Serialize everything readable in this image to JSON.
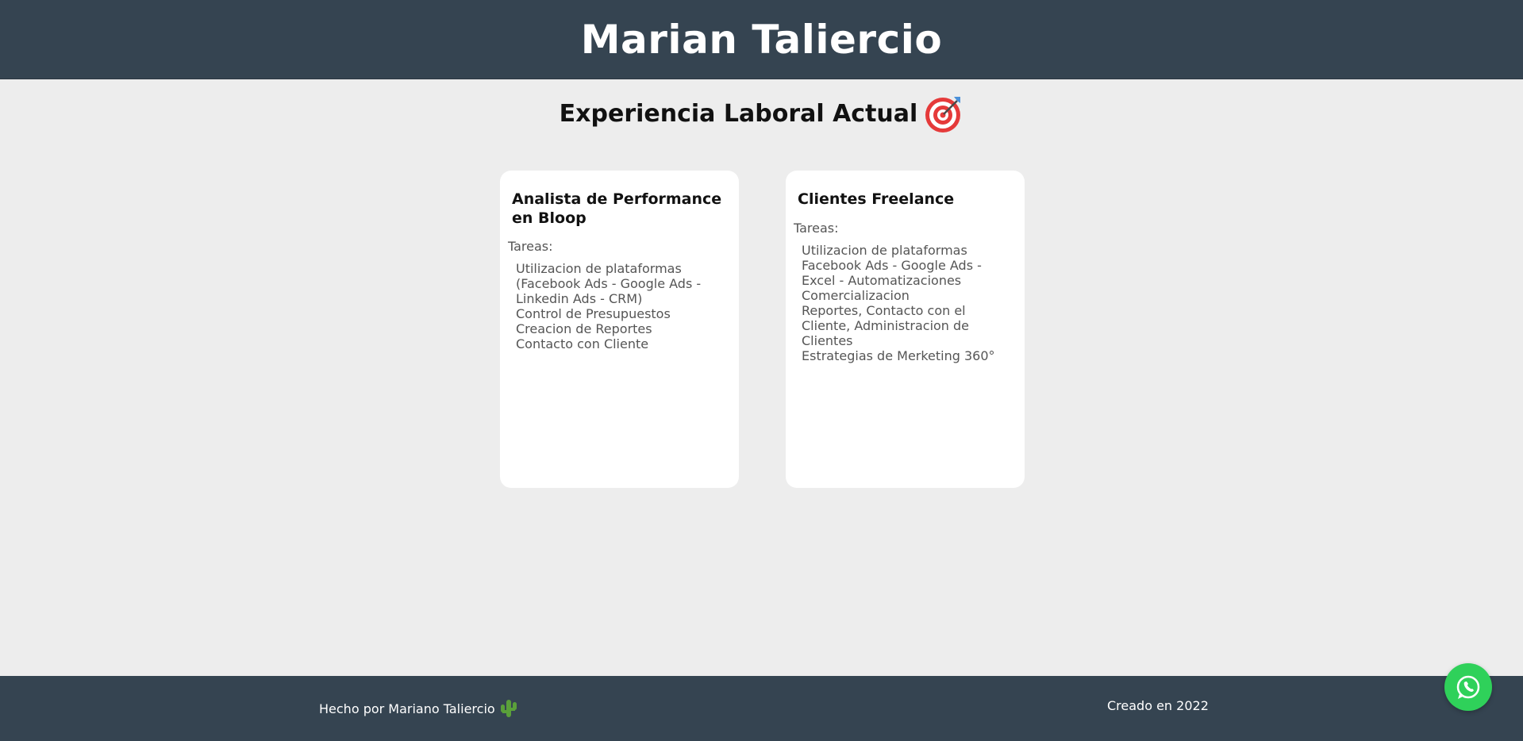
{
  "header": {
    "title": "Marian Taliercio"
  },
  "section": {
    "title": "Experiencia Laboral Actual",
    "icon": "target-icon"
  },
  "cards": [
    {
      "title": "Analista de Performance en Bloop",
      "label": "Tareas:",
      "tasks": [
        "Utilizacion de plataformas (Facebook Ads - Google Ads - Linkedin Ads - CRM)",
        "Control de Presupuestos",
        "Creacion de Reportes",
        "Contacto con Cliente"
      ]
    },
    {
      "title": "Clientes Freelance",
      "label": "Tareas:",
      "tasks": [
        "Utilizacion de plataformas Facebook Ads - Google Ads - Excel - Automatizaciones",
        "Comercializacion",
        "Reportes, Contacto con el Cliente, Administracion de Clientes",
        "Estrategias de Merketing 360°"
      ]
    }
  ],
  "footer": {
    "left_text": "Hecho por Mariano Taliercio",
    "left_icon": "cactus-icon",
    "right_text": "Creado en 2022"
  },
  "floating": {
    "icon": "whatsapp-icon"
  },
  "colors": {
    "header_bg": "#354451",
    "page_bg": "#ededed",
    "card_bg": "#ffffff",
    "whatsapp_green": "#2fd15a"
  }
}
